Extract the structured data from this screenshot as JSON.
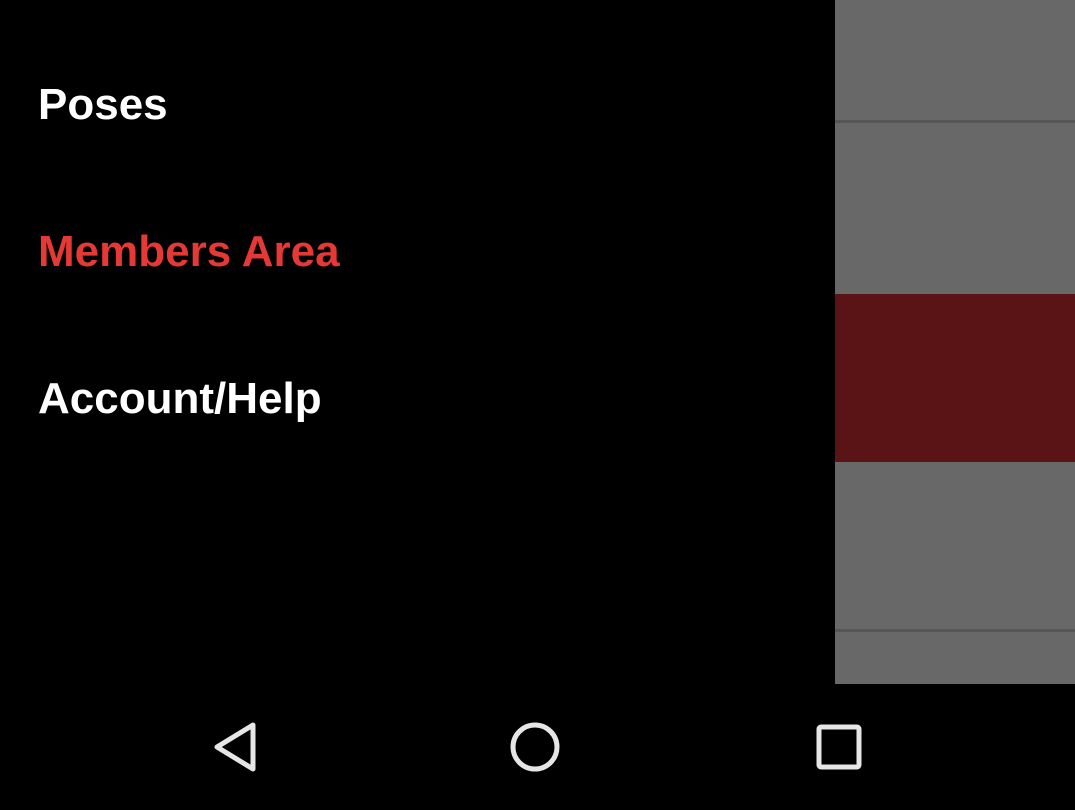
{
  "drawer": {
    "items": [
      {
        "label": "Poses",
        "active": false
      },
      {
        "label": "Members Area",
        "active": true
      },
      {
        "label": "Account/Help",
        "active": false
      }
    ]
  },
  "colors": {
    "active_item": "#e53935",
    "inactive_item": "#ffffff",
    "scrim_gray": "#686868",
    "scrim_red": "#5a1416",
    "nav_icon": "#e6e6e6"
  },
  "system_nav": {
    "icons": [
      "back-icon",
      "home-icon",
      "recents-icon"
    ]
  }
}
